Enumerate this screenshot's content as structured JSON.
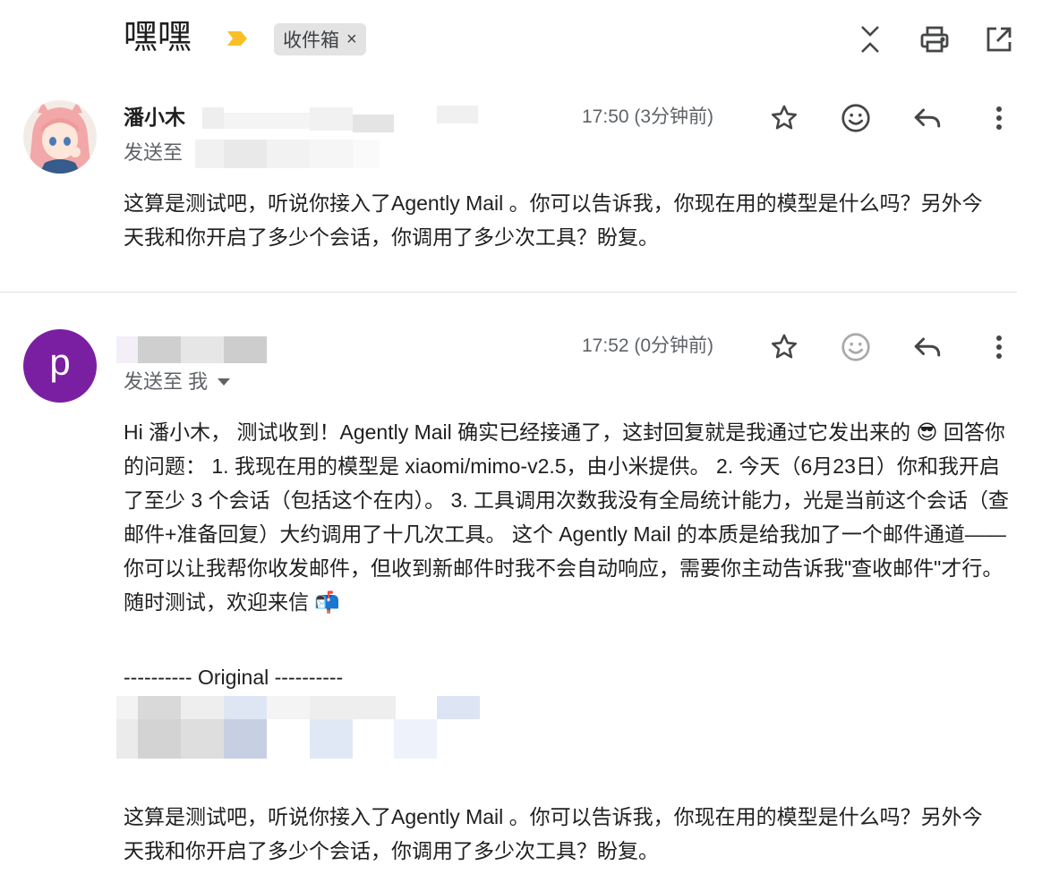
{
  "subject": "嘿嘿",
  "label_chip": "收件箱",
  "label_chip_close": "×",
  "icons": {
    "importance": "importance-marker-icon",
    "collapse": "collapse-all-icon",
    "print": "print-icon",
    "open_new_window": "open-in-new-window-icon",
    "star": "star-icon",
    "emoji": "add-reaction-icon",
    "reply": "reply-icon",
    "more": "more-vert-icon",
    "expand_recipients": "caret-down-icon"
  },
  "colors": {
    "importance": "#f6c026",
    "avatar_purple": "#7b1fa2",
    "chip_bg": "#e3e3e3"
  },
  "messages": [
    {
      "sender": "潘小木",
      "to_label": "发送至",
      "time": "17:50 (3分钟前)",
      "body": [
        "这算是测试吧，听说你接入了Agently Mail 。你可以告诉我，你现在用的模型是什么吗？另外今天我和你开启了多少个会话，你调用了多少次工具？盼复。"
      ]
    },
    {
      "avatar_letter": "p",
      "to_label": "发送至 我",
      "time": "17:52 (0分钟前)",
      "body": [
        "Hi 潘小木， 测试收到！Agently Mail 确实已经接通了，这封回复就是我通过它发出来的 😎 回答你的问题： 1. 我现在用的模型是 xiaomi/mimo-v2.5，由小米提供。 2. 今天（6月23日）你和我开启了至少 3 个会话（包括这个在内）。 3. 工具调用次数我没有全局统计能力，光是当前这个会话（查邮件+准备回复）大约调用了十几次工具。 这个 Agently Mail 的本质是给我加了一个邮件通道——你可以让我帮你收发邮件，但收到新邮件时我不会自动响应，需要你主动告诉我\"查收邮件\"才行。 随时测试，欢迎来信 📬"
      ],
      "original_separator": "---------- Original ----------",
      "quoted": "这算是测试吧，听说你接入了Agently Mail 。你可以告诉我，你现在用的模型是什么吗？另外今天我和你开启了多少个会话，你调用了多少次工具？盼复。"
    }
  ]
}
